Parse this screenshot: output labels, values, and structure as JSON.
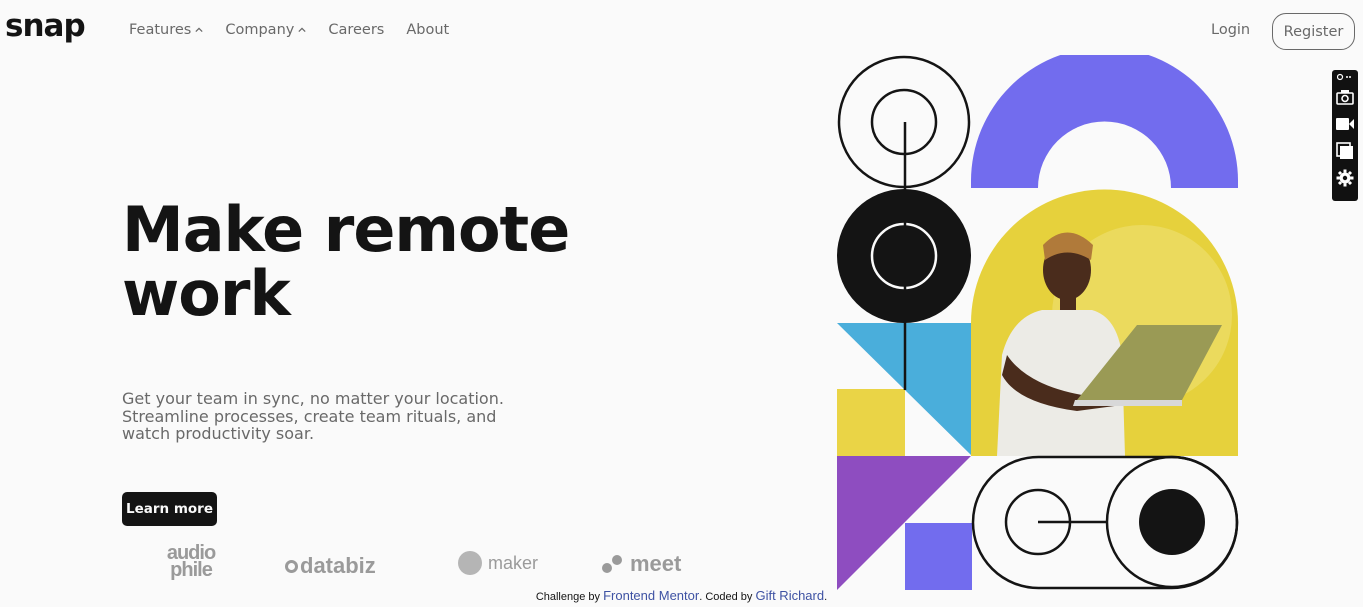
{
  "header": {
    "logo": "snap",
    "nav": [
      {
        "label": "Features",
        "has_dropdown": true
      },
      {
        "label": "Company",
        "has_dropdown": true
      },
      {
        "label": "Careers",
        "has_dropdown": false
      },
      {
        "label": "About",
        "has_dropdown": false
      }
    ],
    "login": "Login",
    "register": "Register"
  },
  "hero": {
    "title_line1": "Make remote",
    "title_line2": "work",
    "text": "Get your team in sync, no matter your location. Streamline processes, create team rituals, and watch productivity soar.",
    "cta": "Learn more",
    "image": "man-with-laptop-photo"
  },
  "clients": {
    "audiophile_line1": "audio",
    "audiophile_line2": "phile",
    "databiz": "databiz",
    "maker": "maker",
    "meet": "meet"
  },
  "attribution": {
    "prefix": "Challenge by ",
    "challenge_link": "Frontend Mentor",
    "middle": ". Coded by ",
    "author_link": "Gift Richard",
    "suffix": "."
  },
  "extension_toolbar": {
    "icons": [
      "link-icon",
      "camera-icon",
      "video-icon",
      "window-icon",
      "gear-icon"
    ]
  },
  "colors": {
    "background": "#fafafa",
    "text_dark": "#141414",
    "text_gray": "#696969",
    "purple": "#726cee",
    "yellow": "#ead446",
    "blue": "#4aaedb",
    "violet": "#8e4dc0"
  }
}
